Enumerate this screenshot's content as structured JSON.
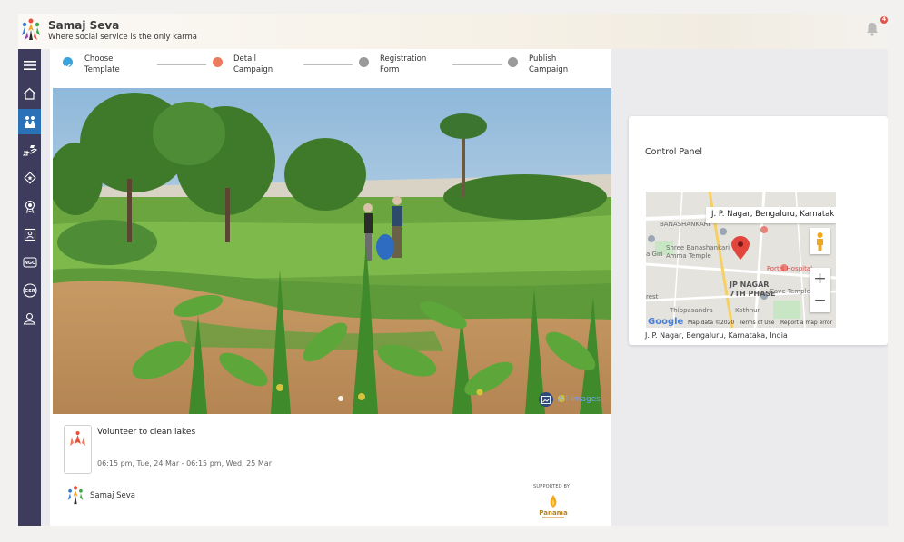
{
  "header": {
    "brand_title": "Samaj Seva",
    "brand_subtitle": "Where social service is the only karma",
    "notification_count": "4"
  },
  "sidebar": {
    "items": [
      {
        "icon": "menu-icon"
      },
      {
        "icon": "home-icon"
      },
      {
        "icon": "volunteer-icon",
        "active": true
      },
      {
        "icon": "donate-hand-icon"
      },
      {
        "icon": "badge-icon"
      },
      {
        "icon": "award-icon"
      },
      {
        "icon": "user-card-icon"
      },
      {
        "icon": "ngo-icon",
        "text": "NGO"
      },
      {
        "icon": "csr-icon",
        "text": "CSR"
      },
      {
        "icon": "profile-icon"
      }
    ]
  },
  "stepper": {
    "steps": [
      {
        "label_line1": "Choose",
        "label_line2": "Template",
        "state": "done",
        "color": "#3ba3d9"
      },
      {
        "label_line1": "Detail",
        "label_line2": "Campaign",
        "state": "current",
        "color": "#ec7a5d"
      },
      {
        "label_line1": "Registration",
        "label_line2": "Form",
        "state": "pending",
        "color": "#9a9a9a"
      },
      {
        "label_line1": "Publish",
        "label_line2": "Campaign",
        "state": "pending",
        "color": "#9a9a9a"
      }
    ]
  },
  "media": {
    "gallery_label": "All Images"
  },
  "event": {
    "title": "Volunteer to clean lakes",
    "time": "06:15 pm, Tue, 24 Mar - 06:15 pm, Wed, 25 Mar",
    "organizer": "Samaj Seva",
    "supported_by": "SUPPORTED BY"
  },
  "control_panel": {
    "title": "Control Panel",
    "map": {
      "place_label": "J. P. Nagar, Bengaluru, Karnatak",
      "labels": [
        "BANASHANKARI",
        "Shree Banashankari",
        "Amma Temple",
        "JP NAGAR",
        "7TH PHASE",
        "Fortis Hospital",
        "Cave Temple",
        "Thippasandra",
        "Kothnur",
        "a Giri",
        "rest"
      ],
      "footer_data": "Map data ©2020",
      "footer_terms": "Terms of Use",
      "footer_report": "Report a map error",
      "brand": "Google",
      "zoom_in": "+",
      "zoom_out": "−"
    },
    "address": "J. P. Nagar, Bengaluru, Karnataka, India"
  }
}
